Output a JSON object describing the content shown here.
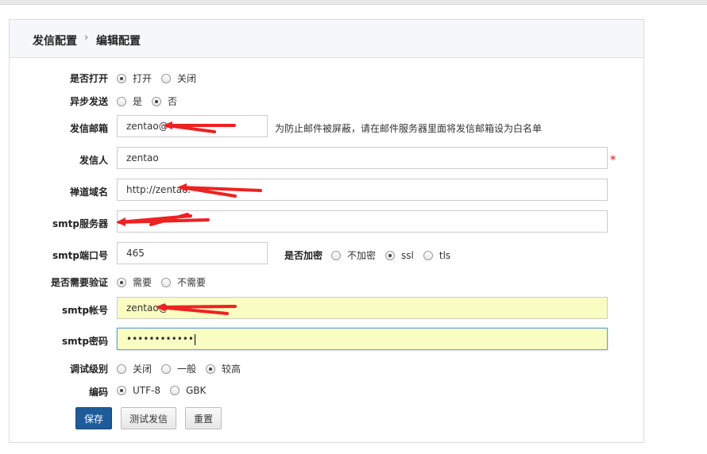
{
  "breadcrumb": {
    "section": "发信配置",
    "separator": "›",
    "page": "编辑配置"
  },
  "form": {
    "enable": {
      "label": "是否打开",
      "options": [
        "打开",
        "关闭"
      ],
      "selected": "打开"
    },
    "async": {
      "label": "异步发送",
      "options": [
        "是",
        "否"
      ],
      "selected": "否"
    },
    "sender_email": {
      "label": "发信邮箱",
      "value": "zentao@",
      "hint": "为防止邮件被屏蔽，请在邮件服务器里面将发信邮箱设为白名单"
    },
    "sender_name": {
      "label": "发信人",
      "value": "zentao",
      "required_mark": "*"
    },
    "domain": {
      "label": "禅道域名",
      "value": "http://zentao."
    },
    "smtp_host": {
      "label": "smtp服务器",
      "value": ""
    },
    "smtp_port": {
      "label": "smtp端口号",
      "value": "465"
    },
    "encryption": {
      "label": "是否加密",
      "options": [
        "不加密",
        "ssl",
        "tls"
      ],
      "selected": "ssl"
    },
    "auth": {
      "label": "是否需要验证",
      "options": [
        "需要",
        "不需要"
      ],
      "selected": "需要"
    },
    "smtp_user": {
      "label": "smtp帐号",
      "value": "zentao@"
    },
    "smtp_password": {
      "label": "smtp密码",
      "value": "••••••••••••"
    },
    "debug": {
      "label": "调试级别",
      "options": [
        "关闭",
        "一般",
        "较高"
      ],
      "selected": "较高"
    },
    "charset": {
      "label": "编码",
      "options": [
        "UTF-8",
        "GBK"
      ],
      "selected": "UTF-8"
    }
  },
  "buttons": {
    "save": "保存",
    "test": "测试发信",
    "reset": "重置"
  },
  "colors": {
    "primary_button": "#1e5b9a",
    "required": "#d9534f",
    "autofill": "#fafdc2",
    "annotation": "#ee2222"
  }
}
